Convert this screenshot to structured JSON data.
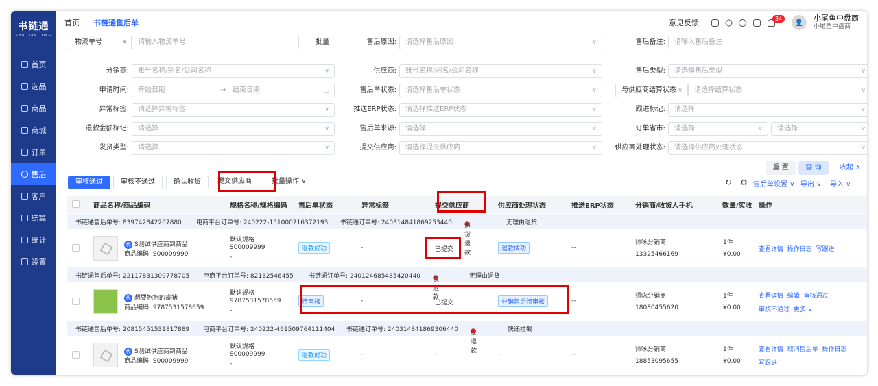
{
  "brand": {
    "name": "书链通",
    "sub": "SHU LIAN TONG"
  },
  "nav": [
    {
      "label": "首页",
      "icon": "monitor-icon"
    },
    {
      "label": "选品",
      "icon": "select-icon"
    },
    {
      "label": "商品",
      "icon": "goods-icon"
    },
    {
      "label": "商城",
      "icon": "mall-icon"
    },
    {
      "label": "订单",
      "icon": "order-icon"
    },
    {
      "label": "售后",
      "icon": "headset-icon"
    },
    {
      "label": "客户",
      "icon": "customer-icon"
    },
    {
      "label": "结算",
      "icon": "settle-icon"
    },
    {
      "label": "统计",
      "icon": "stats-icon"
    },
    {
      "label": "设置",
      "icon": "settings-icon"
    }
  ],
  "topbar": {
    "tabs": [
      "首页",
      "书链通售后单"
    ],
    "feedback": "意见反馈",
    "badge": "34",
    "user_name": "小尾鱼中盘商",
    "user_sub": "小尾鱼中盘商"
  },
  "filters": {
    "row0": {
      "sel": "物流单号",
      "ph": "请输入物流单号",
      "batch": "批量",
      "l2": "售后原因:",
      "p2": "请选择售后原因",
      "l3": "售后备注:",
      "p3": "请输入售后备注"
    },
    "row1": {
      "l1": "分销商:",
      "p1": "账号名称/别名/公司名称",
      "l2": "供应商:",
      "p2": "账号名称/别名/公司名称",
      "l3": "售后类型:",
      "p3": "请选择售后类型"
    },
    "row2": {
      "l1": "申请时间:",
      "start": "开始日期",
      "sep": "→",
      "end": "结束日期",
      "l2": "售后单状态:",
      "p2": "请选择售后单状态",
      "sel3": "与供应商结算状态",
      "p3": "请选择结算状态"
    },
    "row3": {
      "l1": "异常标签:",
      "p1": "请选择异常标签",
      "l2": "推送ERP状态:",
      "p2": "请选择推送ERP状态",
      "l3": "跟进标记:",
      "p3": "请选择"
    },
    "row4": {
      "l1": "退款金额标记:",
      "p1": "请选择",
      "l2": "售后单来源:",
      "p2": "请选择",
      "l3": "订单省市:",
      "p3a": "请选择",
      "p3b": "请选择"
    },
    "row5": {
      "l1": "发货类型:",
      "p1": "请选择",
      "l2": "提交供应商:",
      "p2": "请选择提交供应商",
      "l3": "供应商处理状态:",
      "p3": "请选择供应商处理状态"
    },
    "reset": "重 置",
    "query": "查 询",
    "collapse": "收起"
  },
  "actions": {
    "approve": "审核通过",
    "reject": "审核不通过",
    "confirm": "确认收货",
    "submit": "提交供应商",
    "batch": "批量操作",
    "settings": "售后单设置",
    "export": "导出",
    "import": "导入"
  },
  "columns": [
    "商品名称/商品编码",
    "规格名称/规格编码",
    "售后单状态",
    "异常标签",
    "提交供应商",
    "供应商处理状态",
    "推送ERP状态",
    "分销商/收货人手机",
    "数量/实收",
    "操作"
  ],
  "orders": [
    {
      "g1": "书链通售后单号: 839742842207880",
      "g2": "电商平台订单号: 240222-151000216372193",
      "g3": "书链通订单号: 240314841869253440",
      "g4": "退货退款",
      "g5": "无理由退货",
      "name": "S测试供应商到商品",
      "code": "商品编码: S00009999",
      "spec": "默认规格",
      "spec_code": "S00009999",
      "dash": "-",
      "status": "退款成功",
      "abnormal": "-",
      "submit": "已提交",
      "sup_status": "退款成功",
      "erp": "--",
      "distributor": "师咏分销商",
      "phone": "13325466169",
      "qty": "1件",
      "amount": "¥0.00",
      "ops": [
        "查看详情",
        "操作日志",
        "写跟进"
      ]
    },
    {
      "g1": "书链通售后单号: 22117831309778705",
      "g2": "电商平台订单号: 82132546455",
      "g3": "书链通订单号: 240124685485420440",
      "g4": "仅退款",
      "g5": "无理由退货",
      "name": "想要抱抱的豪猪",
      "code": "商品编码: 9787531578659",
      "spec": "默认规格",
      "spec_code": "9787531578659",
      "dash": "-",
      "status": "待审核",
      "abnormal": "-",
      "submit": "已提交",
      "sup_status": "分销售后待审核",
      "erp": "--",
      "distributor": "师咏分销商",
      "phone": "18080455620",
      "qty": "1件",
      "amount": "¥0.00",
      "ops": [
        "查看详情",
        "编辑",
        "审核通过",
        "审核不通过",
        "更多"
      ]
    },
    {
      "g1": "书链通售后单号: 20815451531817889",
      "g2": "电商平台订单号: 240222-461509764111404",
      "g3": "书链通订单号: 240314841869306440",
      "g4": "仅退款",
      "g5": "快递拦截",
      "name": "S测试供应商到商品",
      "code": "商品编码: S00009999",
      "spec": "默认规格",
      "spec_code": "S00009999",
      "dash": "-",
      "status": "退款成功",
      "abnormal": "-",
      "submit": "-",
      "sup_status": "-",
      "erp": "--",
      "distributor": "师咏分销商",
      "phone": "18853095655",
      "qty": "1件",
      "amount": "¥0.00",
      "ops": [
        "查看详情",
        "取消售后单",
        "操作日志",
        "写跟进"
      ]
    }
  ],
  "colors": {
    "sidebar": "#1e3a8a",
    "primary": "#2f6bff",
    "highlight": "#e00000"
  }
}
